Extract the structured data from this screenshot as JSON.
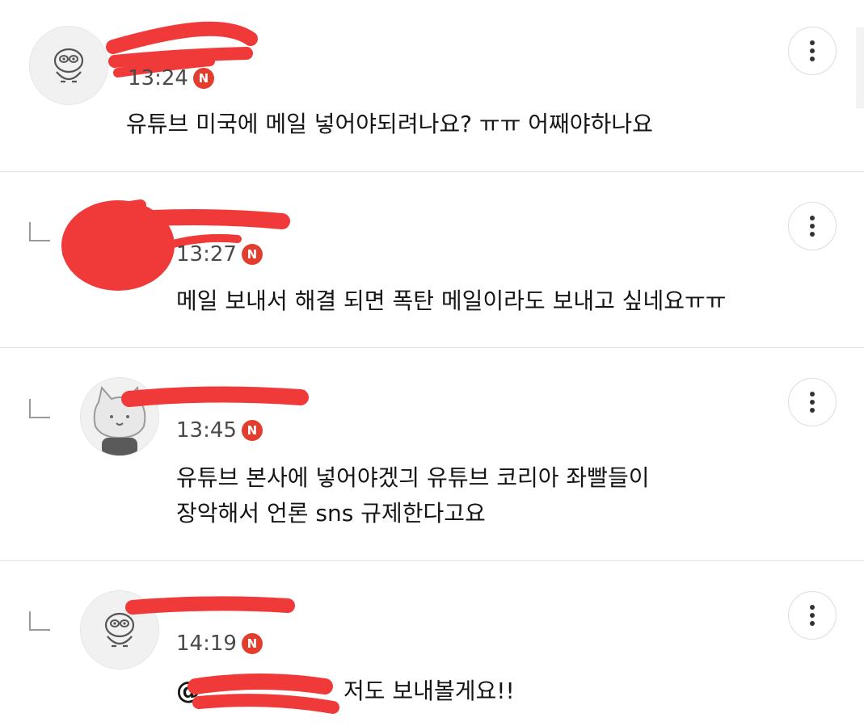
{
  "comments": [
    {
      "time": "13:24",
      "badge": "N",
      "text": "유튜브 미국에 메일 넣어야되려나요?  ㅠㅠ 어째야하나요",
      "is_reply": false
    },
    {
      "time": "13:27",
      "badge": "N",
      "text": "메일 보내서 해결 되면 폭탄 메일이라도 보내고 싶네요ㅠㅠ",
      "is_reply": true
    },
    {
      "time": "13:45",
      "badge": "N",
      "text": "유튜브 본사에 넣어야겠긔 유튜브 코리아 좌빨들이\n장악해서 언론 sns 규제한다고요",
      "is_reply": true
    },
    {
      "time": "14:19",
      "badge": "N",
      "mention_prefix": "@",
      "text": "저도 보내볼게요!!",
      "is_reply": true
    }
  ],
  "icons": {
    "more": "more-vertical-icon",
    "reply": "reply-arrow-icon",
    "new_badge": "new-badge-icon"
  },
  "colors": {
    "badge": "#e23d2d",
    "redaction": "#f03a3a",
    "divider": "#e2e2e2"
  }
}
